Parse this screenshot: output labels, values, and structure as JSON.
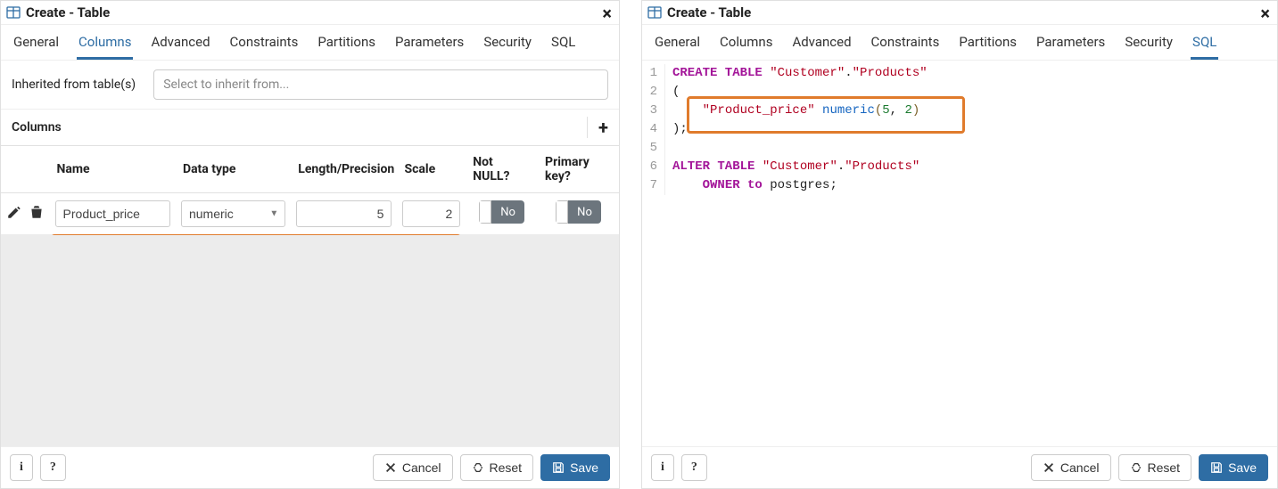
{
  "window_title": "Create - Table",
  "tabs": {
    "general": "General",
    "columns": "Columns",
    "advanced": "Advanced",
    "constraints": "Constraints",
    "partitions": "Partitions",
    "parameters": "Parameters",
    "security": "Security",
    "sql": "SQL"
  },
  "left_active_tab": "Columns",
  "right_active_tab": "SQL",
  "inherit_label": "Inherited from table(s)",
  "inherit_placeholder": "Select to inherit from...",
  "columns_section_label": "Columns",
  "columns_headers": {
    "name": "Name",
    "datatype": "Data type",
    "length": "Length/Precision",
    "scale": "Scale",
    "notnull": "Not NULL?",
    "pkey": "Primary key?"
  },
  "toggle_no": "No",
  "row": {
    "name": "Product_price",
    "datatype": "numeric",
    "length": "5",
    "scale": "2"
  },
  "sql_lines": [
    {
      "n": "1",
      "segments": [
        {
          "t": "CREATE TABLE ",
          "c": "kw"
        },
        {
          "t": "\"Customer\"",
          "c": "str"
        },
        {
          "t": ".",
          "c": ""
        },
        {
          "t": "\"Products\"",
          "c": "str"
        }
      ]
    },
    {
      "n": "2",
      "segments": [
        {
          "t": "(",
          "c": ""
        }
      ]
    },
    {
      "n": "3",
      "segments": [
        {
          "t": "    ",
          "c": ""
        },
        {
          "t": "\"Product_price\"",
          "c": "str"
        },
        {
          "t": " ",
          "c": ""
        },
        {
          "t": "numeric",
          "c": "ty"
        },
        {
          "t": "(",
          "c": "pn"
        },
        {
          "t": "5",
          "c": "num"
        },
        {
          "t": ", ",
          "c": ""
        },
        {
          "t": "2",
          "c": "num"
        },
        {
          "t": ")",
          "c": "pn"
        }
      ]
    },
    {
      "n": "4",
      "segments": [
        {
          "t": ");",
          "c": ""
        }
      ]
    },
    {
      "n": "5",
      "segments": [
        {
          "t": "",
          "c": ""
        }
      ]
    },
    {
      "n": "6",
      "segments": [
        {
          "t": "ALTER TABLE ",
          "c": "kw"
        },
        {
          "t": "\"Customer\"",
          "c": "str"
        },
        {
          "t": ".",
          "c": ""
        },
        {
          "t": "\"Products\"",
          "c": "str"
        }
      ]
    },
    {
      "n": "7",
      "segments": [
        {
          "t": "    ",
          "c": ""
        },
        {
          "t": "OWNER to ",
          "c": "kw"
        },
        {
          "t": "postgres;",
          "c": ""
        }
      ]
    }
  ],
  "footer": {
    "info": "i",
    "help": "?",
    "cancel": "Cancel",
    "reset": "Reset",
    "save": "Save"
  }
}
